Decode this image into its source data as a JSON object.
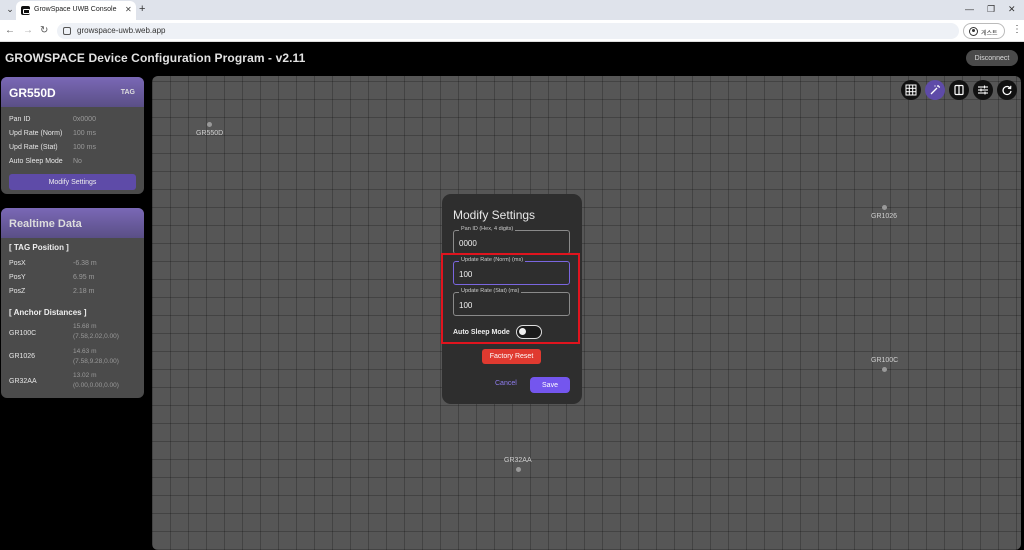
{
  "browser": {
    "tab_title": "GrowSpace UWB Console",
    "url": "growspace-uwb.web.app",
    "guest_label": "게스트"
  },
  "app": {
    "title": "GROWSPACE Device Configuration Program - v2.11",
    "disconnect_label": "Disconnect"
  },
  "device_card": {
    "name": "GR550D",
    "type_label": "TAG",
    "rows": [
      {
        "label": "Pan ID",
        "value": "0x0000"
      },
      {
        "label": "Upd Rate (Norm)",
        "value": "100 ms"
      },
      {
        "label": "Upd Rate (Stat)",
        "value": "100 ms"
      },
      {
        "label": "Auto Sleep Mode",
        "value": "No"
      }
    ],
    "modify_label": "Modify Settings"
  },
  "realtime": {
    "title": "Realtime Data",
    "tag_position_title": "[ TAG Position ]",
    "position": [
      {
        "label": "PosX",
        "value": "-6.38 m"
      },
      {
        "label": "PosY",
        "value": "6.95 m"
      },
      {
        "label": "PosZ",
        "value": "2.18 m"
      }
    ],
    "anchor_distances_title": "[ Anchor Distances ]",
    "distances": [
      {
        "label": "GR100C",
        "distance": "15.68 m",
        "coords": "(7.58,2.02,0.00)"
      },
      {
        "label": "GR1026",
        "distance": "14.63 m",
        "coords": "(7.58,9.28,0.00)"
      },
      {
        "label": "GR32AA",
        "distance": "13.02 m",
        "coords": "(0.00,0.00,0.00)"
      }
    ]
  },
  "canvas": {
    "anchors": [
      {
        "label": "GR550D"
      },
      {
        "label": "GR1026"
      },
      {
        "label": "GR100C"
      },
      {
        "label": "GR32AA"
      }
    ],
    "tools": [
      "grid-icon",
      "magic-wand-icon",
      "split-view-icon",
      "sliders-icon",
      "refresh-icon"
    ]
  },
  "modal": {
    "title": "Modify Settings",
    "pan_id_label": "Pan ID (Hex, 4 digits)",
    "pan_id_value": "0000",
    "norm_label": "Update Rate (Norm) (ms)",
    "norm_value": "100",
    "stat_label": "Update Rate (Stat) (ms)",
    "stat_value": "100",
    "auto_sleep_label": "Auto Sleep Mode",
    "auto_sleep_on": false,
    "factory_reset_label": "Factory Reset",
    "cancel_label": "Cancel",
    "save_label": "Save"
  },
  "colors": {
    "accent": "#7456ee",
    "danger": "#e03a30",
    "highlight": "#e0141e"
  }
}
